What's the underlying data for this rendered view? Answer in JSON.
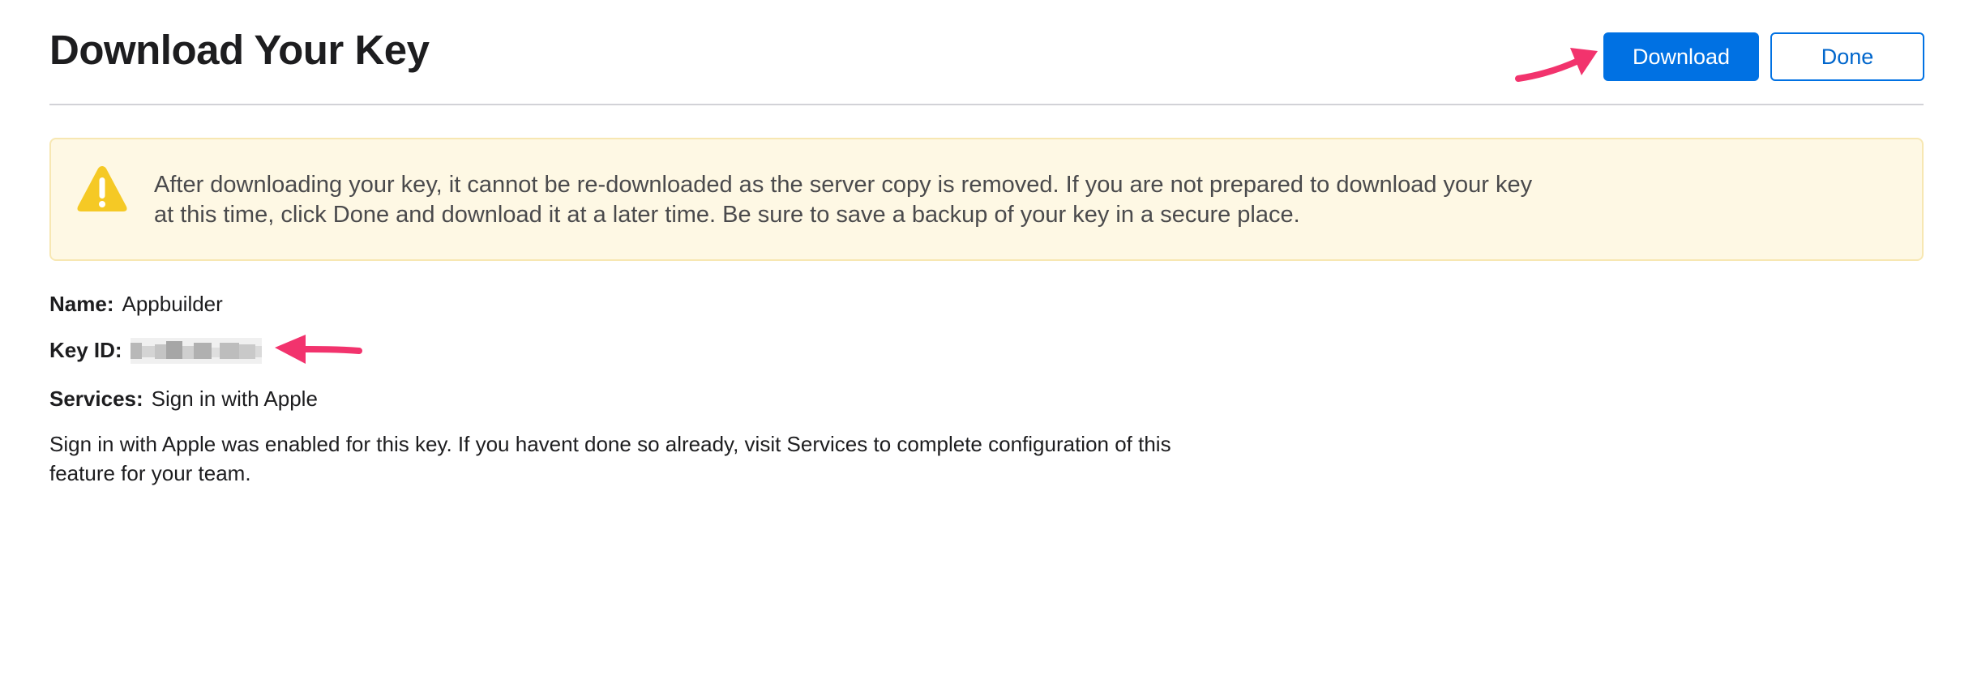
{
  "header": {
    "title": "Download Your Key",
    "download_label": "Download",
    "done_label": "Done"
  },
  "warning": {
    "icon": "warning-triangle-icon",
    "text": "After downloading your key, it cannot be re-downloaded as the server copy is removed. If you are not prepared to download your key at this time, click Done and download it at a later time. Be sure to save a backup of your key in a secure place."
  },
  "details": {
    "name_label": "Name:",
    "name_value": "Appbuilder",
    "key_id_label": "Key ID:",
    "services_label": "Services:",
    "services_value": "Sign in with Apple"
  },
  "note": "Sign in with Apple was enabled for this key. If you havent done so already, visit Services to complete configuration of this feature for your team.",
  "colors": {
    "accent": "#0071e3",
    "warning_bg": "#fef8e4",
    "warning_icon": "#f5c925",
    "annotation_arrow": "#f2336d"
  }
}
